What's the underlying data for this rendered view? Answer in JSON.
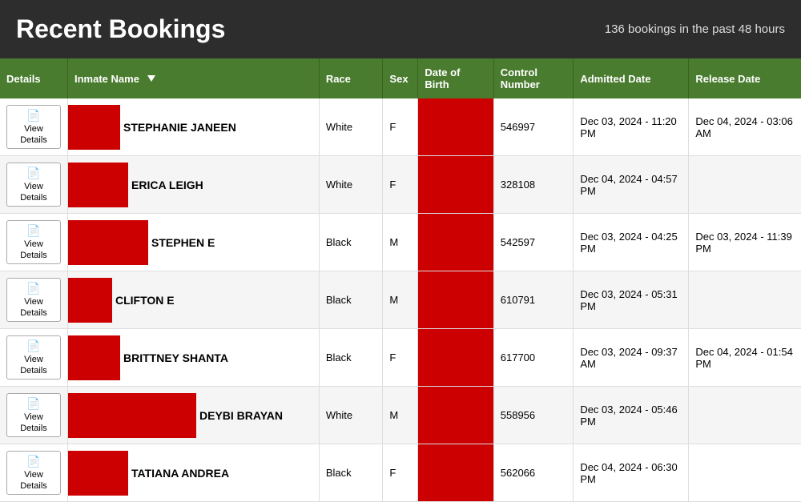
{
  "header": {
    "title": "Recent Bookings",
    "subtitle": "136 bookings in the past 48 hours"
  },
  "columns": {
    "details": "Details",
    "inmate_name": "Inmate Name",
    "race": "Race",
    "sex": "Sex",
    "dob": "Date of Birth",
    "control_number": "Control Number",
    "admitted_date": "Admitted Date",
    "release_date": "Release Date"
  },
  "buttons": {
    "view": "View",
    "details": "Details"
  },
  "rows": [
    {
      "name": "STEPHANIE JANEEN",
      "race": "White",
      "sex": "F",
      "control_number": "546997",
      "admitted_date": "Dec 03, 2024 - 11:20 PM",
      "release_date": "Dec 04, 2024 - 03:06 AM",
      "red_block_width": 65
    },
    {
      "name": "ERICA LEIGH",
      "race": "White",
      "sex": "F",
      "control_number": "328108",
      "admitted_date": "Dec 04, 2024 - 04:57 PM",
      "release_date": "",
      "red_block_width": 75
    },
    {
      "name": "STEPHEN E",
      "race": "Black",
      "sex": "M",
      "control_number": "542597",
      "admitted_date": "Dec 03, 2024 - 04:25 PM",
      "release_date": "Dec 03, 2024 - 11:39 PM",
      "red_block_width": 100
    },
    {
      "name": "CLIFTON E",
      "race": "Black",
      "sex": "M",
      "control_number": "610791",
      "admitted_date": "Dec 03, 2024 - 05:31 PM",
      "release_date": "",
      "red_block_width": 55
    },
    {
      "name": "BRITTNEY SHANTA",
      "race": "Black",
      "sex": "F",
      "control_number": "617700",
      "admitted_date": "Dec 03, 2024 - 09:37 AM",
      "release_date": "Dec 04, 2024 - 01:54 PM",
      "red_block_width": 65
    },
    {
      "name": "DEYBI BRAYAN",
      "race": "White",
      "sex": "M",
      "control_number": "558956",
      "admitted_date": "Dec 03, 2024 - 05:46 PM",
      "release_date": "",
      "red_block_width": 160
    },
    {
      "name": "TATIANA ANDREA",
      "race": "Black",
      "sex": "F",
      "control_number": "562066",
      "admitted_date": "Dec 04, 2024 - 06:30 PM",
      "release_date": "",
      "red_block_width": 75
    }
  ]
}
